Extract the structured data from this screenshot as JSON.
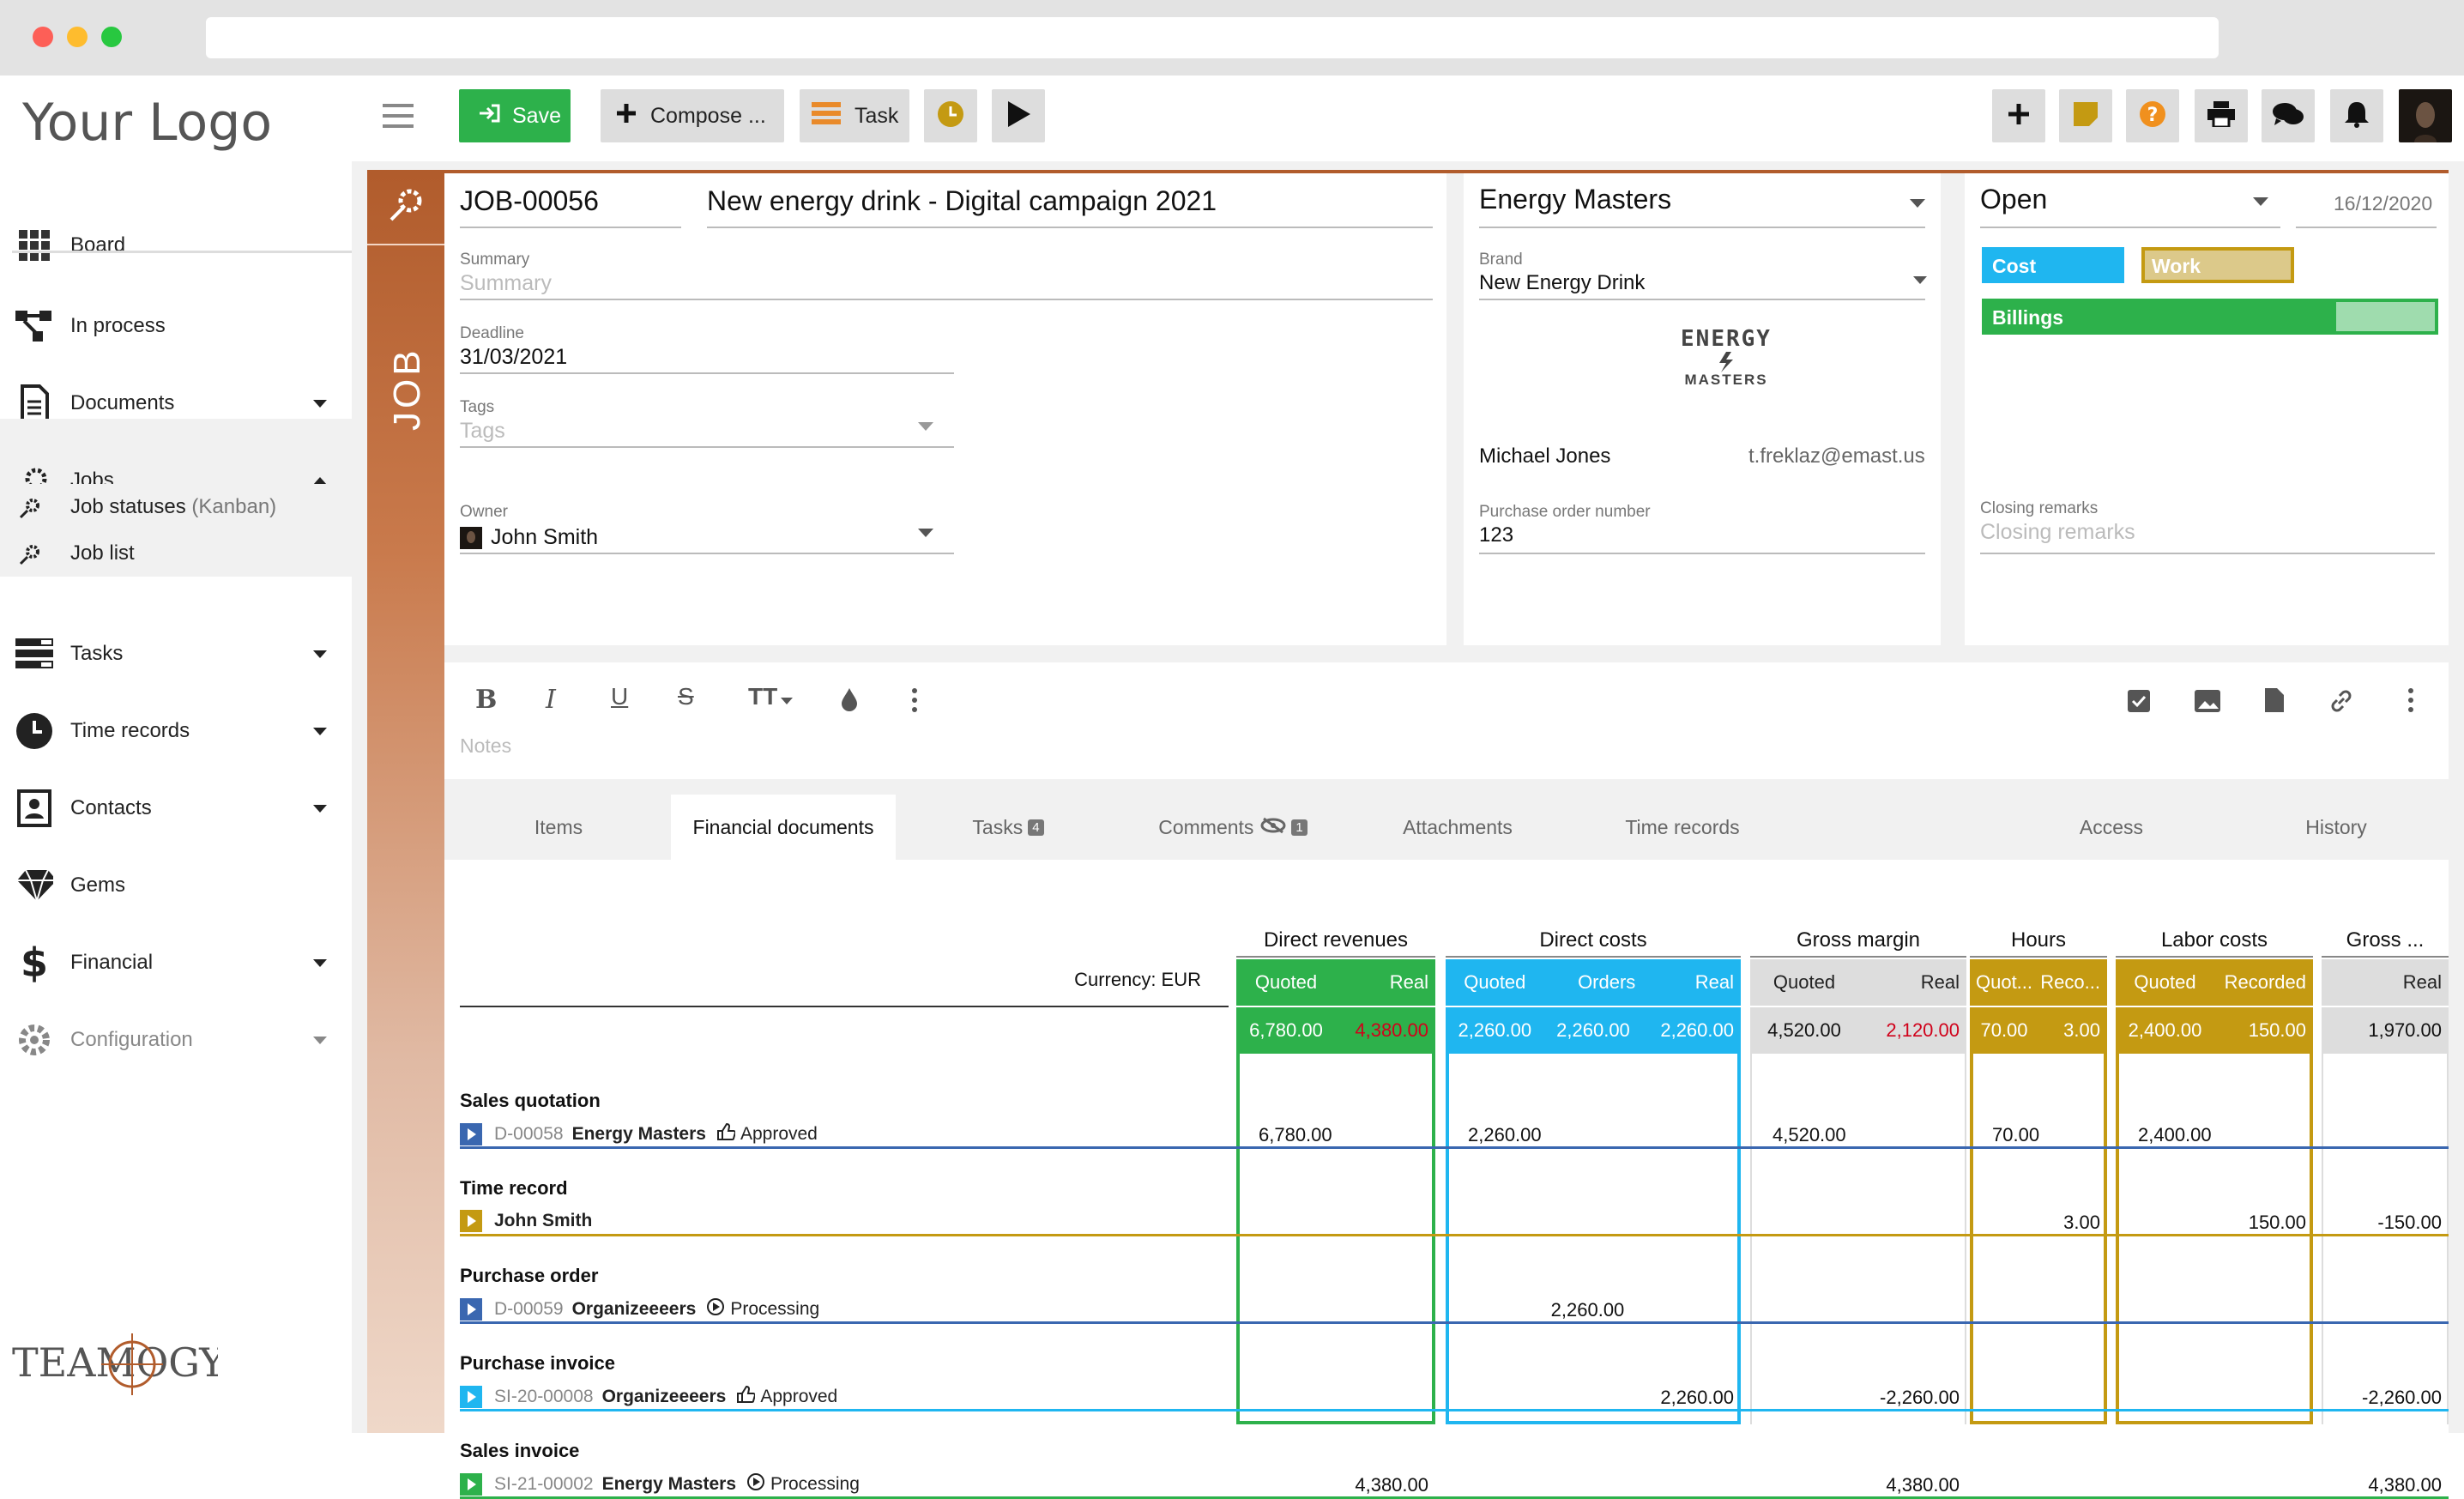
{
  "colors": {
    "green": "#2db14b",
    "cyan": "#1fb6f0",
    "gold": "#c49a12",
    "blue": "#3a67b0",
    "orange": "#b15c2c"
  },
  "sidebar": {
    "logo": "Your Logo",
    "brand": "TEAMOGY",
    "items": [
      {
        "label": "Board",
        "icon": "grid-icon"
      },
      {
        "label": "In process",
        "icon": "process-icon"
      },
      {
        "label": "Documents",
        "icon": "document-icon"
      },
      {
        "label": "Jobs",
        "icon": "gear-rocket-icon"
      },
      {
        "label": "Tasks",
        "icon": "tasks-icon"
      },
      {
        "label": "Time records",
        "icon": "clock-icon"
      },
      {
        "label": "Contacts",
        "icon": "contact-icon"
      },
      {
        "label": "Gems",
        "icon": "gem-icon"
      },
      {
        "label": "Financial",
        "icon": "dollar-icon"
      },
      {
        "label": "Configuration",
        "icon": "cog-icon"
      }
    ],
    "sub": [
      {
        "label": "Job statuses",
        "suffix": "(Kanban)"
      },
      {
        "label": "Job list"
      }
    ]
  },
  "toolbar": {
    "save": "Save",
    "compose": "Compose ...",
    "task": "Task"
  },
  "job": {
    "strip": "JOB",
    "number": "JOB-00056",
    "title": "New energy drink - Digital campaign 2021",
    "summary_label": "Summary",
    "summary_ph": "Summary",
    "deadline_label": "Deadline",
    "deadline": "31/03/2021",
    "tags_label": "Tags",
    "tags_ph": "Tags",
    "owner_label": "Owner",
    "owner": "John Smith"
  },
  "client": {
    "name": "Energy Masters",
    "brand_label": "Brand",
    "brand": "New Energy Drink",
    "logo_top": "ENERGY",
    "logo_bottom": "MASTERS",
    "contact": "Michael Jones",
    "email": "t.freklaz@emast.us",
    "po_label": "Purchase order number",
    "po": "123"
  },
  "status": {
    "value": "Open",
    "date": "16/12/2020",
    "cost": "Cost",
    "work": "Work",
    "billings": "Billings",
    "billings_progress": 0.78,
    "closing_label": "Closing remarks",
    "closing_ph": "Closing remarks"
  },
  "notes": {
    "ph": "Notes"
  },
  "tabs": [
    {
      "label": "Items"
    },
    {
      "label": "Financial documents"
    },
    {
      "label": "Tasks",
      "badge": "4"
    },
    {
      "label": "Comments",
      "badge": "1"
    },
    {
      "label": "Attachments"
    },
    {
      "label": "Time records"
    },
    {
      "label": "Access"
    },
    {
      "label": "History"
    }
  ],
  "fin": {
    "currency": "Currency: EUR",
    "groups": [
      "Direct revenues",
      "Direct costs",
      "Gross margin",
      "Hours",
      "Labor costs",
      "Gross ..."
    ],
    "subs": {
      "rev": [
        "Quoted",
        "Real"
      ],
      "cost": [
        "Quoted",
        "Orders",
        "Real"
      ],
      "gm": [
        "Quoted",
        "Real"
      ],
      "hours": [
        "Quot...",
        "Reco..."
      ],
      "labor": [
        "Quoted",
        "Recorded"
      ],
      "gross": [
        "Real"
      ]
    },
    "totals": {
      "rev": [
        "6,780.00",
        "4,380.00"
      ],
      "cost": [
        "2,260.00",
        "2,260.00",
        "2,260.00"
      ],
      "gm": [
        "4,520.00",
        "2,120.00"
      ],
      "hours": [
        "70.00",
        "3.00"
      ],
      "labor": [
        "2,400.00",
        "150.00"
      ],
      "gross": [
        "1,970.00"
      ]
    },
    "rows": [
      {
        "title": "Sales quotation",
        "ref": "D-00058",
        "party": "Energy Masters",
        "state": "Approved",
        "v": {
          "rev_q": "6,780.00",
          "cost_q": "2,260.00",
          "gm_q": "4,520.00",
          "hours_q": "70.00",
          "labor_q": "2,400.00"
        }
      },
      {
        "title": "Time record",
        "ref": "",
        "party": "John Smith",
        "state": "",
        "v": {
          "hours_r": "3.00",
          "labor_r": "150.00",
          "gross_r": "-150.00"
        }
      },
      {
        "title": "Purchase order",
        "ref": "D-00059",
        "party": "Organizeeeers",
        "state": "Processing",
        "v": {
          "cost_o": "2,260.00"
        }
      },
      {
        "title": "Purchase invoice",
        "ref": "SI-20-00008",
        "party": "Organizeeeers",
        "state": "Approved",
        "v": {
          "cost_r": "2,260.00",
          "gm_r": "-2,260.00",
          "gross_r": "-2,260.00"
        }
      },
      {
        "title": "Sales invoice",
        "ref": "SI-21-00002",
        "party": "Energy Masters",
        "state": "Processing",
        "v": {
          "rev_r": "4,380.00",
          "gm_r": "4,380.00",
          "gross_r": "4,380.00"
        }
      }
    ]
  }
}
